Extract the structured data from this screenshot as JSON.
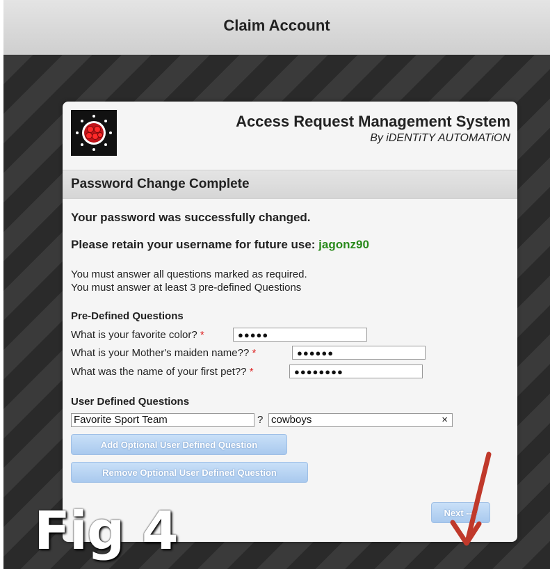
{
  "header": {
    "title": "Claim Account"
  },
  "app": {
    "name": "Access Request Management System",
    "subtitle": "By iDENTiTY AUTOMATiON",
    "logo_icon": "red-dots-sun-logo"
  },
  "section": {
    "title": "Password Change Complete"
  },
  "messages": {
    "success": "Your password was successfully changed.",
    "retain_prefix": "Please retain your username for future use: ",
    "username": "jagonz90",
    "instruction_1": "You must answer all questions marked as required.",
    "instruction_2": "You must answer at least 3 pre-defined Questions"
  },
  "predefined": {
    "heading": "Pre-Defined Questions",
    "questions": [
      {
        "label": "What is your favorite color?",
        "required": "*",
        "masked_value": "●●●●●"
      },
      {
        "label": "What is your Mother's maiden name??",
        "required": "*",
        "masked_value": "●●●●●●"
      },
      {
        "label": "What was the name of your first pet??",
        "required": "*",
        "masked_value": "●●●●●●●●"
      }
    ]
  },
  "user_defined": {
    "heading": "User Defined Questions",
    "question_value": "Favorite Sport Team",
    "question_mark": "?",
    "answer_value": "cowboys",
    "clear_icon": "×"
  },
  "buttons": {
    "add_label": "Add Optional User Defined Question",
    "remove_label": "Remove Optional User Defined Question",
    "next_label": "Next -->"
  },
  "overlay": {
    "fig_label": "Fig 4",
    "arrow_color": "#c0392b"
  },
  "colors": {
    "username": "#2a8a1c",
    "required": "#dd2222",
    "button": "#b5d1f2"
  }
}
